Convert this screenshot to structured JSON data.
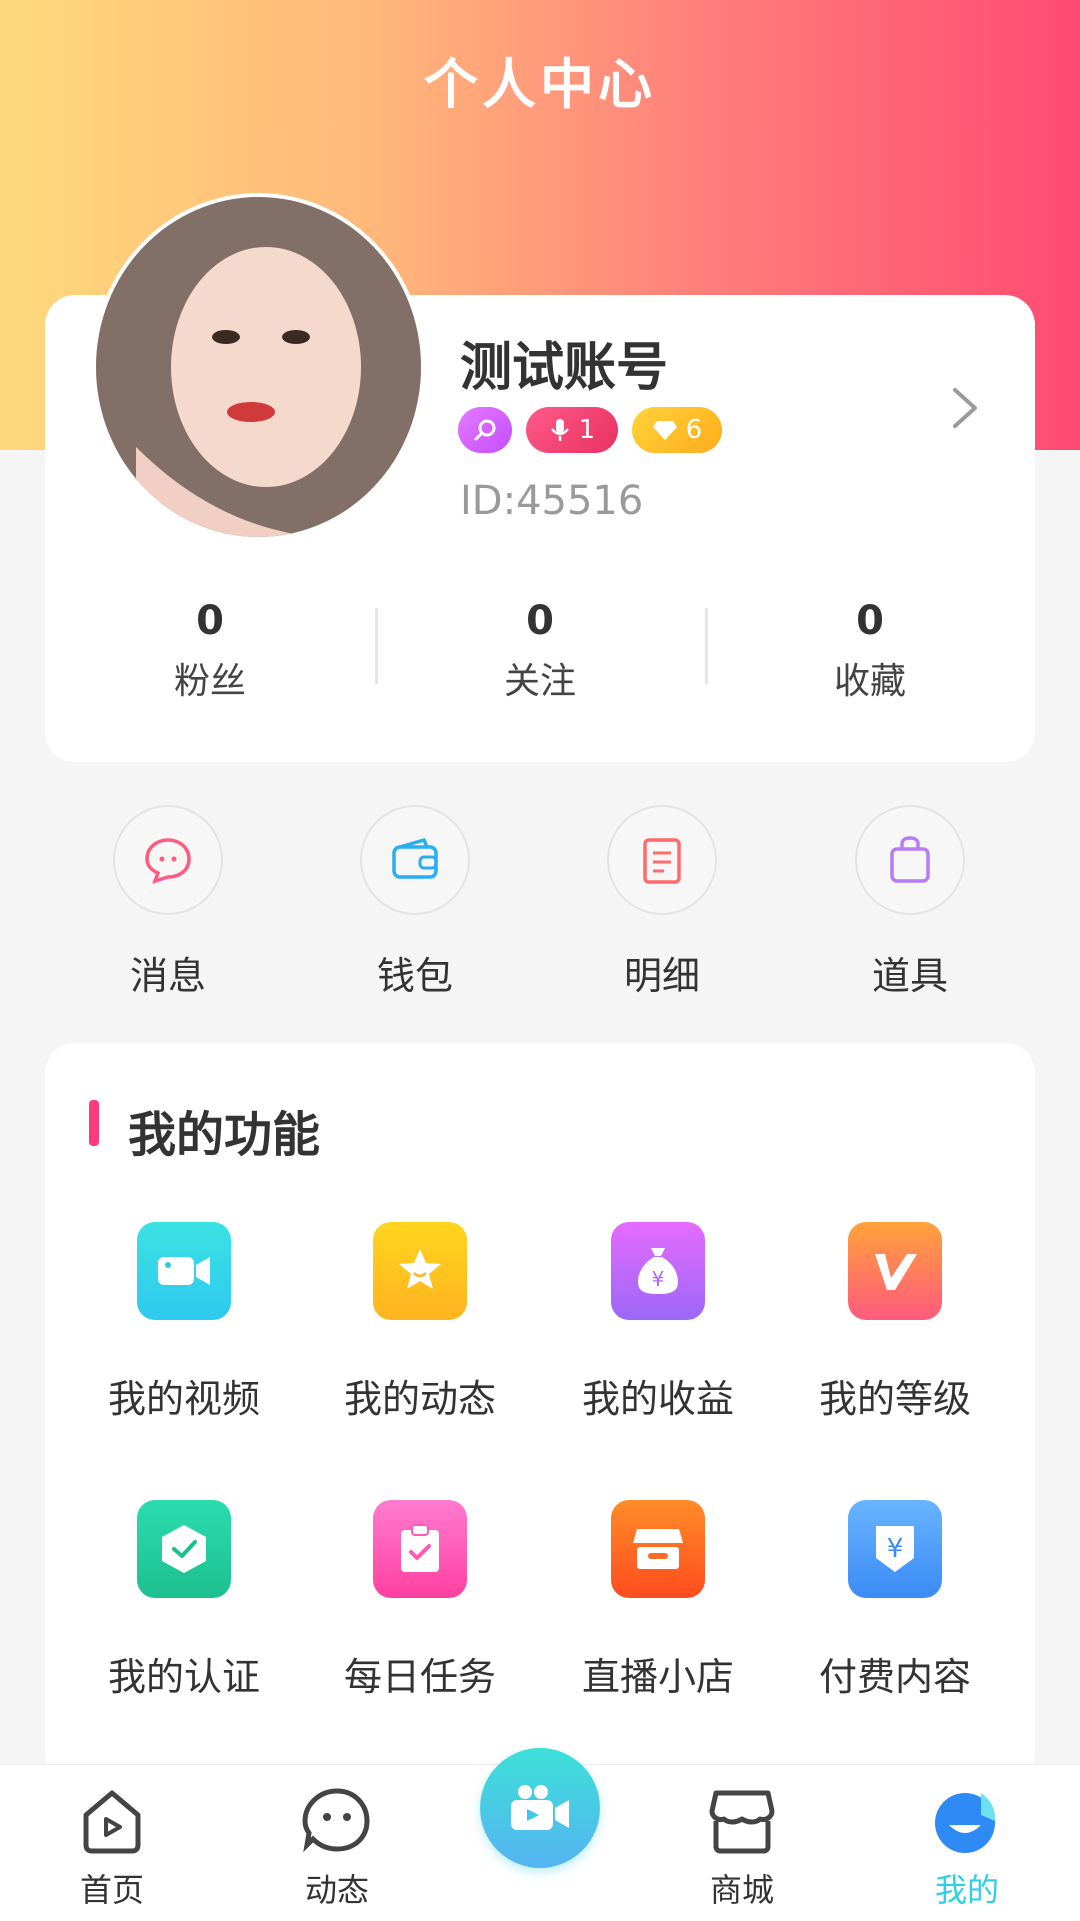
{
  "header": {
    "title": "个人中心"
  },
  "profile": {
    "username": "测试账号",
    "badges": [
      {
        "icon": "search-magnifier-icon",
        "text": "",
        "color": "#d45cff"
      },
      {
        "icon": "microphone-icon",
        "text": "1",
        "color": "#f03f72"
      },
      {
        "icon": "diamond-icon",
        "text": "6",
        "color": "#ffc12e"
      }
    ],
    "id_text": "ID:45516"
  },
  "stats": [
    {
      "value": "0",
      "label": "粉丝"
    },
    {
      "value": "0",
      "label": "关注"
    },
    {
      "value": "0",
      "label": "收藏"
    }
  ],
  "quick_actions": [
    {
      "label": "消息",
      "icon": "message-bubble-icon"
    },
    {
      "label": "钱包",
      "icon": "wallet-icon"
    },
    {
      "label": "明细",
      "icon": "document-list-icon"
    },
    {
      "label": "道具",
      "icon": "shopping-bag-icon"
    }
  ],
  "functions": {
    "title": "我的功能",
    "items": [
      {
        "label": "我的视频",
        "icon": "video-camera-icon"
      },
      {
        "label": "我的动态",
        "icon": "star-icon"
      },
      {
        "label": "我的收益",
        "icon": "money-bag-icon"
      },
      {
        "label": "我的等级",
        "icon": "level-v-icon"
      },
      {
        "label": "我的认证",
        "icon": "shield-check-icon"
      },
      {
        "label": "每日任务",
        "icon": "clipboard-check-icon"
      },
      {
        "label": "直播小店",
        "icon": "store-icon"
      },
      {
        "label": "付费内容",
        "icon": "paid-shield-yen-icon"
      }
    ]
  },
  "tabbar": {
    "items": [
      {
        "label": "首页",
        "icon": "home-play-icon"
      },
      {
        "label": "动态",
        "icon": "face-bubble-icon"
      },
      {
        "label": "商城",
        "icon": "shop-icon"
      },
      {
        "label": "我的",
        "icon": "profile-face-icon",
        "active": true
      }
    ],
    "center_icon": "live-camera-icon"
  },
  "colors": {
    "accent": "#2ed0e6",
    "brand_pink": "#ff3a7b"
  }
}
